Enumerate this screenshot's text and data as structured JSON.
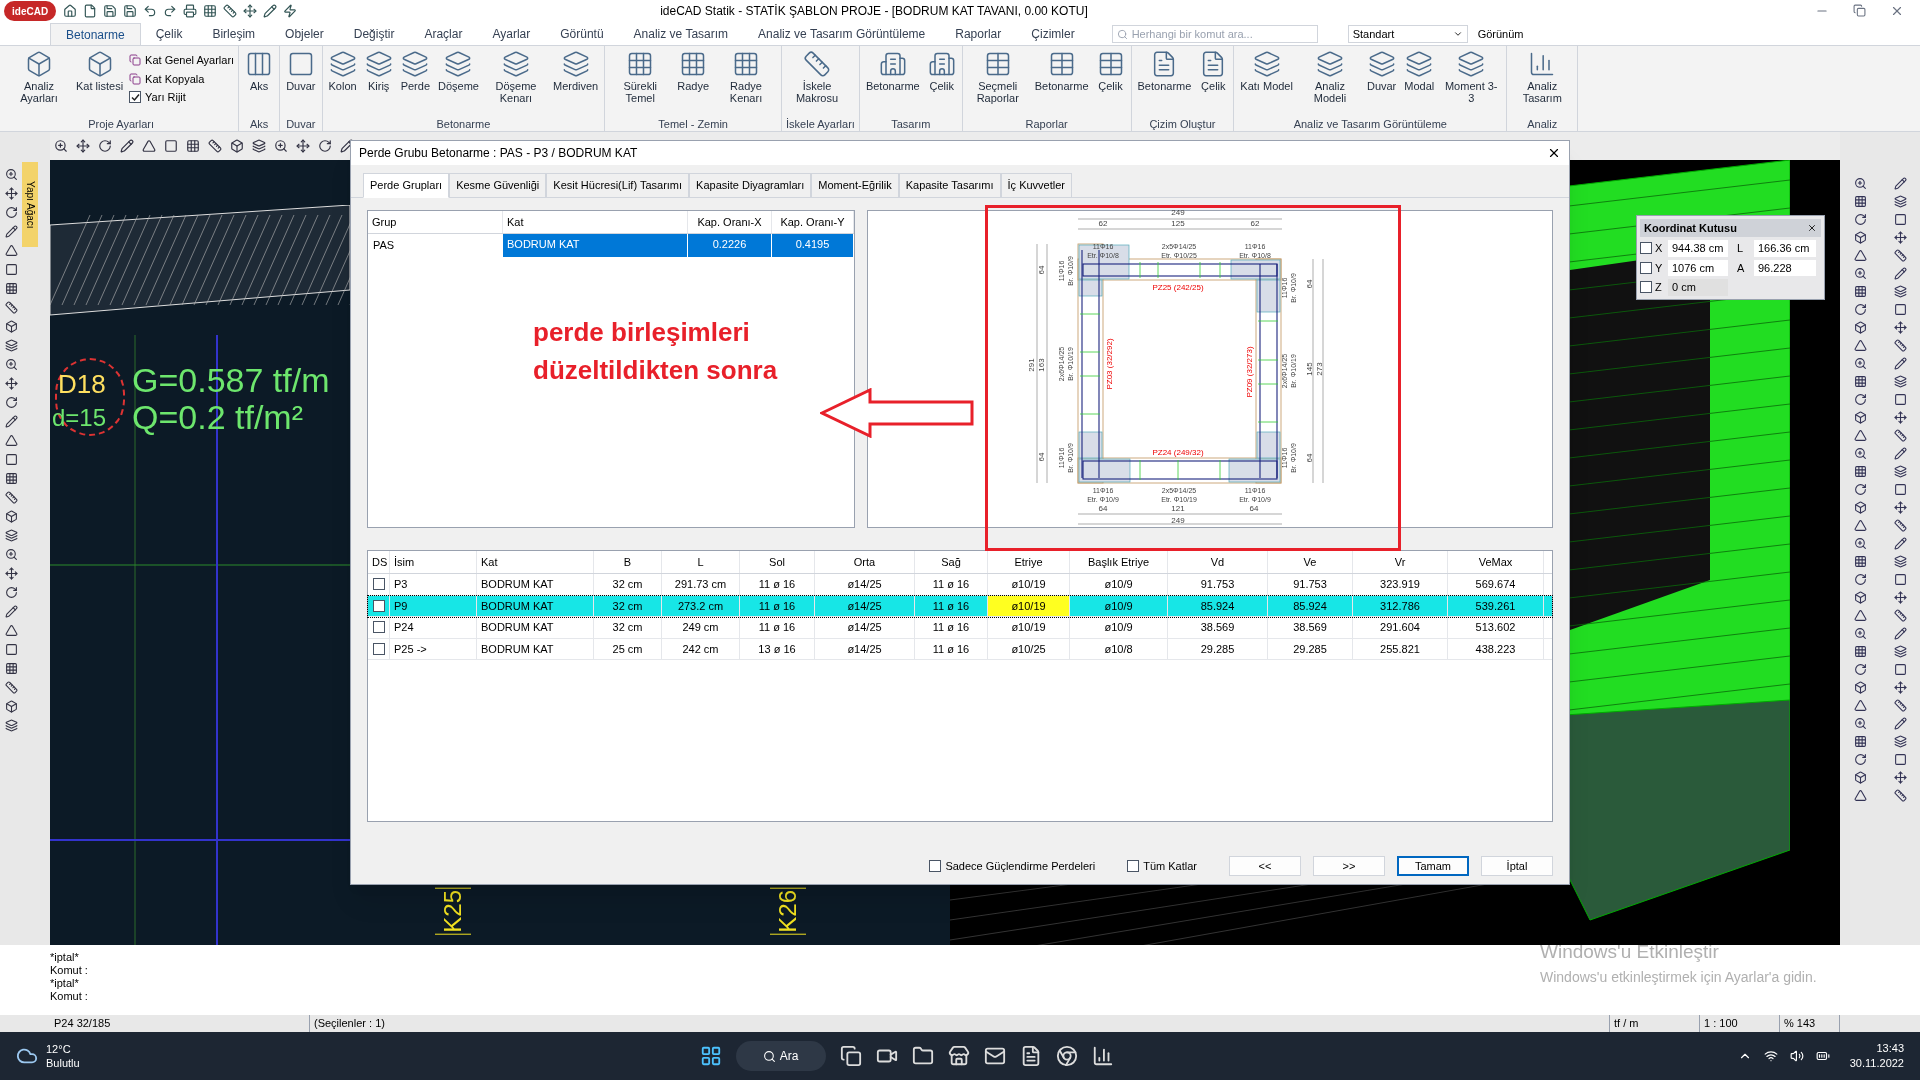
{
  "window": {
    "title": "ideCAD Statik - STATİK ŞABLON PROJE - [BODRUM KAT TAVANI,  0.00 KOTU]",
    "logo": "ideCAD",
    "search": {
      "placeholder": "Herhangi bir komut ara..."
    },
    "style_select": "Standart",
    "view_menu": "Görünüm"
  },
  "menu_tabs": [
    {
      "label": "Betonarme",
      "selected": true
    },
    {
      "label": "Çelik",
      "selected": false
    },
    {
      "label": "Birleşim",
      "selected": false
    },
    {
      "label": "Objeler",
      "selected": false
    },
    {
      "label": "Değiştir",
      "selected": false
    },
    {
      "label": "Araçlar",
      "selected": false
    },
    {
      "label": "Ayarlar",
      "selected": false
    },
    {
      "label": "Görüntü",
      "selected": false
    },
    {
      "label": "Analiz ve Tasarım",
      "selected": false
    },
    {
      "label": "Analiz ve Tasarım Görüntüleme",
      "selected": false
    },
    {
      "label": "Raporlar",
      "selected": false
    },
    {
      "label": "Çizimler",
      "selected": false
    }
  ],
  "ribbon": [
    {
      "name": "Proje Ayarları",
      "buttons": [
        "Analiz Ayarları",
        "Kat listesi"
      ],
      "small": [
        {
          "label": "Kat Genel Ayarları",
          "kind": "command"
        },
        {
          "label": "Kat Kopyala",
          "kind": "command"
        },
        {
          "label": "Yarı Rijit",
          "kind": "checkbox",
          "checked": true
        }
      ]
    },
    {
      "name": "Aks",
      "buttons": [
        "Aks"
      ]
    },
    {
      "name": "Duvar",
      "buttons": [
        "Duvar"
      ]
    },
    {
      "name": "Betonarme",
      "buttons": [
        "Kolon",
        "Kiriş",
        "Perde",
        "Döşeme",
        "Döşeme Kenarı",
        "Merdiven"
      ]
    },
    {
      "name": "Temel - Zemin",
      "buttons": [
        "Sürekli Temel",
        "Radye",
        "Radye Kenarı"
      ]
    },
    {
      "name": "İskele Ayarları",
      "buttons": [
        "İskele Makrosu"
      ]
    },
    {
      "name": "Tasarım",
      "buttons": [
        "Betonarme",
        "Çelik"
      ]
    },
    {
      "name": "Raporlar",
      "buttons": [
        "Seçmeli Raporlar",
        "Betonarme",
        "Çelik"
      ]
    },
    {
      "name": "Çizim Oluştur",
      "buttons": [
        "Betonarme",
        "Çelik"
      ]
    },
    {
      "name": "Analiz ve Tasarım Görüntüleme",
      "buttons": [
        "Katı Model",
        "Analiz Modeli",
        "Duvar",
        "Modal",
        "Moment 3-3"
      ]
    },
    {
      "name": "Analiz",
      "buttons": [
        "Analiz Tasarım"
      ]
    }
  ],
  "side_tab": "Yapı Ağacı",
  "canvas": {
    "slab_id": "D18",
    "slab_thickness": "d=15",
    "dead_load": "G=0.587 tf/m",
    "live_load": "Q=0.2 tf/m²",
    "beam_labels": [
      "K25",
      "K26"
    ]
  },
  "annotation": {
    "lines": [
      "perde birleşimleri",
      "düzeltildikten sonra"
    ]
  },
  "dialog": {
    "title": "Perde Grubu Betonarme  :  PAS - P3 / BODRUM KAT",
    "tabs": [
      {
        "label": "Perde Grupları",
        "selected": true
      },
      {
        "label": "Kesme Güvenliği",
        "selected": false
      },
      {
        "label": "Kesit Hücresi(Lif) Tasarımı",
        "selected": false
      },
      {
        "label": "Kapasite Diyagramları",
        "selected": false
      },
      {
        "label": "Moment-Eğrilik",
        "selected": false
      },
      {
        "label": "Kapasite Tasarımı",
        "selected": false
      },
      {
        "label": "İç Kuvvetler",
        "selected": false
      }
    ],
    "groups_table": {
      "columns": [
        "Grup",
        "Kat",
        "Kap. Oranı-X",
        "Kap. Oranı-Y"
      ],
      "rows": [
        {
          "cells": [
            "PAS",
            "BODRUM KAT",
            "0.2226",
            "0.4195"
          ],
          "selected": true
        }
      ]
    },
    "section_drawing": {
      "top_dims": [
        "249",
        "62",
        "125",
        "62"
      ],
      "bottom_dims": [
        "64",
        "121",
        "64",
        "249"
      ],
      "left_dims": [
        "291",
        "64",
        "163",
        "64"
      ],
      "right_dims": [
        "64",
        "145",
        "64",
        "273"
      ],
      "top_labels": [
        [
          "11Φ16",
          "Etr. Φ10/8"
        ],
        [
          "2x5Φ14/25",
          "Etr. Φ10/25"
        ],
        [
          "11Φ16",
          "Etr. Φ10/8"
        ]
      ],
      "bottom_labels": [
        [
          "11Φ16",
          "Etr. Φ10/9"
        ],
        [
          "2x5Φ14/25",
          "Etr. Φ10/19"
        ],
        [
          "11Φ16",
          "Etr. Φ10/9"
        ]
      ],
      "left_labels": [
        [
          "11Φ16",
          "Br. Φ10/9"
        ],
        [
          "2x6Φ14/25",
          "Br. Φ10/19"
        ],
        [
          "11Φ16",
          "Br. Φ10/9"
        ]
      ],
      "right_labels": [
        [
          "11Φ16",
          "Br. Φ10/9"
        ],
        [
          "2x6Φ14/25",
          "Br. Φ10/19"
        ],
        [
          "11Φ16",
          "Br. Φ10/9"
        ]
      ],
      "wall_labels": [
        "PZ25 (242/25)",
        "PZ24 (249/32)",
        "PZ03 (32/292)",
        "PZ09 (32/273)"
      ]
    },
    "walls_table": {
      "checkbox_header": "DS",
      "columns": [
        "İsim",
        "Kat",
        "B",
        "L",
        "Sol",
        "Orta",
        "Sağ",
        "Etriye",
        "Başlık Etriye",
        "Vd",
        "Ve",
        "Vr",
        "VeMax"
      ],
      "rows": [
        {
          "checked": false,
          "selected": false,
          "etriye_highlighted": false,
          "cells": [
            "P3",
            "BODRUM KAT",
            "32 cm",
            "291.73 cm",
            "11 ø 16",
            "ø14/25",
            "11 ø 16",
            "ø10/19",
            "ø10/9",
            "91.753",
            "91.753",
            "323.919",
            "569.674"
          ]
        },
        {
          "checked": false,
          "selected": true,
          "etriye_highlighted": true,
          "cells": [
            "P9",
            "BODRUM KAT",
            "32 cm",
            "273.2 cm",
            "11 ø 16",
            "ø14/25",
            "11 ø 16",
            "ø10/19",
            "ø10/9",
            "85.924",
            "85.924",
            "312.786",
            "539.261"
          ]
        },
        {
          "checked": false,
          "selected": false,
          "etriye_highlighted": false,
          "cells": [
            "P24",
            "BODRUM KAT",
            "32 cm",
            "249 cm",
            "11 ø 16",
            "ø14/25",
            "11 ø 16",
            "ø10/19",
            "ø10/9",
            "38.569",
            "38.569",
            "291.604",
            "513.602"
          ]
        },
        {
          "checked": false,
          "selected": false,
          "etriye_highlighted": false,
          "cells": [
            "P25 ->",
            "BODRUM KAT",
            "25 cm",
            "242 cm",
            "13 ø 16",
            "ø14/25",
            "11 ø 16",
            "ø10/25",
            "ø10/8",
            "29.285",
            "29.285",
            "255.821",
            "438.223"
          ]
        }
      ]
    },
    "options": [
      {
        "label": "Sadece Güçlendirme Perdeleri",
        "checked": false
      },
      {
        "label": "Tüm Katlar",
        "checked": false
      }
    ],
    "buttons": [
      {
        "label": "<<",
        "default": false
      },
      {
        "label": ">>",
        "default": false
      },
      {
        "label": "Tamam",
        "default": true
      },
      {
        "label": "İptal",
        "default": false
      }
    ]
  },
  "coordinate_box": {
    "title": "Koordinat Kutusu",
    "rows": [
      {
        "axis": "X",
        "checked": false,
        "value": "944.38 cm",
        "extra_label": "L",
        "extra_value": "166.36 cm"
      },
      {
        "axis": "Y",
        "checked": false,
        "value": "1076 cm",
        "extra_label": "A",
        "extra_value": "96.228"
      },
      {
        "axis": "Z",
        "checked": false,
        "value": "0 cm"
      }
    ]
  },
  "command_lines": [
    "*iptal*",
    "Komut :",
    "*iptal*",
    "Komut :"
  ],
  "activation_notice": [
    "Windows'u Etkinleştir",
    "Windows'u etkinleştirmek için Ayarlar'a gidin."
  ],
  "status_bar": [
    "P24 32/185",
    "(Seçilenler : 1)",
    "tf / m",
    "1 : 100",
    "% 143"
  ],
  "taskbar": {
    "temperature": "12°C",
    "weather": "Bulutlu",
    "search": "Ara",
    "time": "13:43",
    "date": "30.11.2022"
  }
}
